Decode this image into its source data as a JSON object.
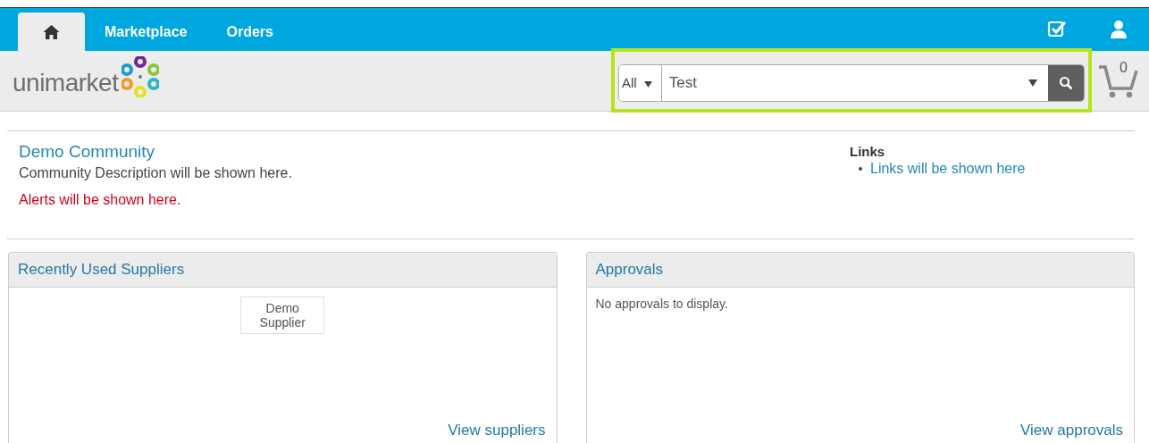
{
  "tabs": [
    {
      "kind": "home",
      "selected": true
    },
    {
      "kind": "text",
      "label": "Marketplace",
      "selected": false
    },
    {
      "kind": "text",
      "label": "Orders",
      "selected": false
    }
  ],
  "logo": {
    "text": "unimarket"
  },
  "search": {
    "scope": "All",
    "value": "Test",
    "highlighted": true
  },
  "cart": {
    "count": "0"
  },
  "community": {
    "title": "Demo Community",
    "description": "Community Description will be shown here.",
    "alert": "Alerts will be shown here."
  },
  "links": {
    "title": "Links",
    "items": [
      "Links will be shown here"
    ]
  },
  "panels": [
    {
      "kind": "suppliers",
      "title": "Recently Used Suppliers",
      "items": [
        "Demo Supplier"
      ],
      "footer_link": "View suppliers"
    },
    {
      "kind": "approvals",
      "title": "Approvals",
      "message": "No approvals to display.",
      "footer_link": "View approvals"
    }
  ]
}
